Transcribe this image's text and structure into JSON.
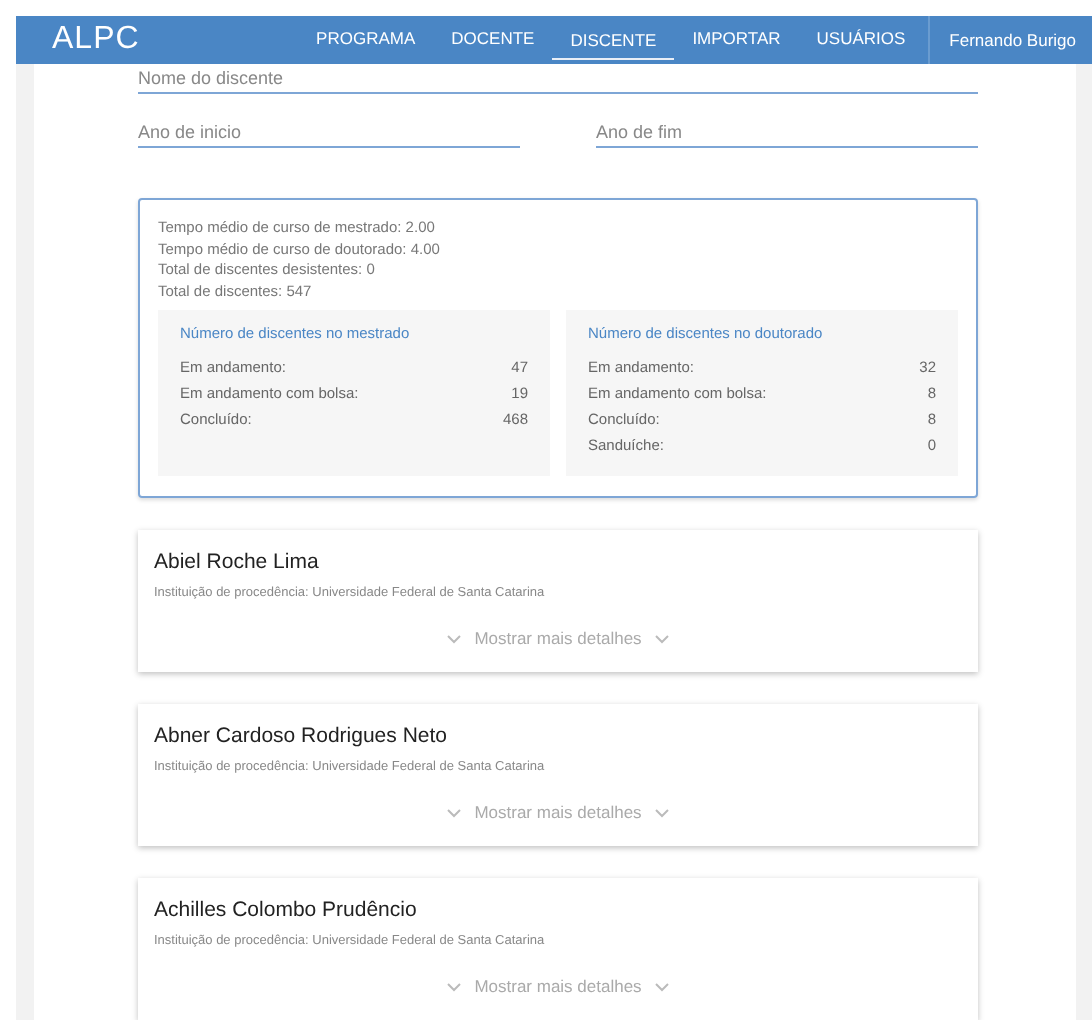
{
  "app_bar": {
    "title": "ALPC",
    "nav": [
      {
        "label": "PROGRAMA",
        "selected": false
      },
      {
        "label": "DOCENTE",
        "selected": false
      },
      {
        "label": "DISCENTE",
        "selected": true
      },
      {
        "label": "IMPORTAR",
        "selected": false
      },
      {
        "label": "USUÁRIOS",
        "selected": false
      }
    ],
    "user": "Fernando Burigo"
  },
  "filters": {
    "name": {
      "placeholder": "Nome do discente"
    },
    "start_year": {
      "placeholder": "Ano de inicio"
    },
    "end_year": {
      "placeholder": "Ano de fim"
    }
  },
  "summary": {
    "lines": [
      "Tempo médio de curso de mestrado: 2.00",
      "Tempo médio de curso de doutorado: 4.00",
      "Total de discentes desistentes: 0",
      "Total de discentes: 547"
    ],
    "panels": [
      {
        "title": "Número de discentes no mestrado",
        "rows": [
          {
            "label": "Em andamento:",
            "value": "47"
          },
          {
            "label": "Em andamento com bolsa:",
            "value": "19"
          },
          {
            "label": "Concluído:",
            "value": "468"
          }
        ]
      },
      {
        "title": "Número de discentes no doutorado",
        "rows": [
          {
            "label": "Em andamento:",
            "value": "32"
          },
          {
            "label": "Em andamento com bolsa:",
            "value": "8"
          },
          {
            "label": "Concluído:",
            "value": "8"
          },
          {
            "label": "Sanduíche:",
            "value": "0"
          }
        ]
      }
    ]
  },
  "students": [
    {
      "name": "Abiel Roche Lima",
      "institution": "Instituição de procedência: Universidade Federal de Santa Catarina",
      "details": "Mostrar mais detalhes"
    },
    {
      "name": "Abner Cardoso Rodrigues Neto",
      "institution": "Instituição de procedência: Universidade Federal de Santa Catarina",
      "details": "Mostrar mais detalhes"
    },
    {
      "name": "Achilles Colombo Prudêncio",
      "institution": "Instituição de procedência: Universidade Federal de Santa Catarina",
      "details": "Mostrar mais detalhes"
    }
  ]
}
